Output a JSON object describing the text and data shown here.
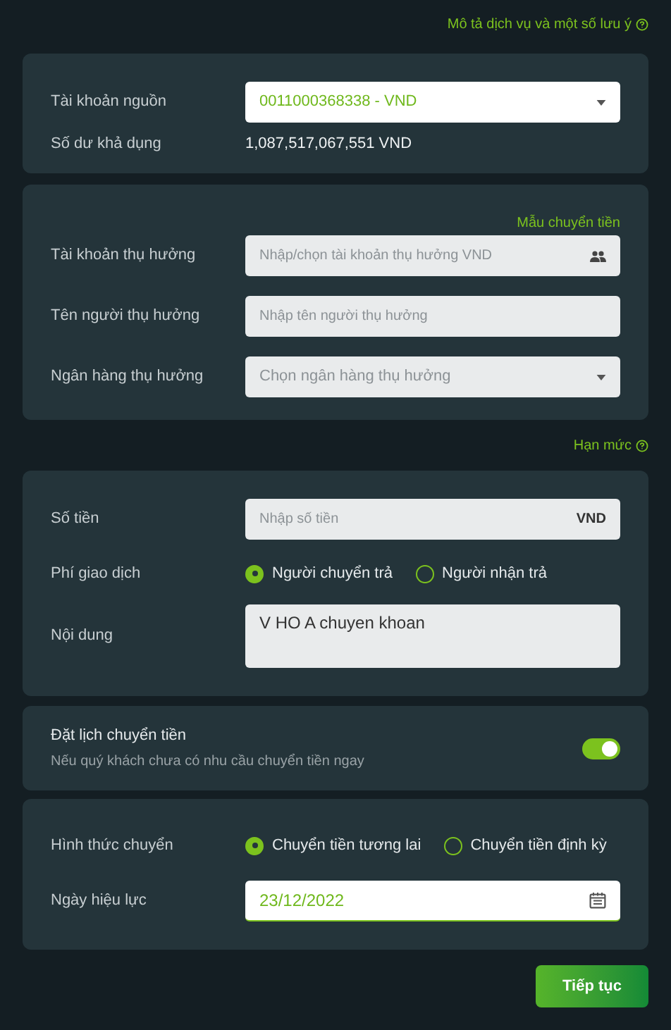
{
  "help_link": "Mô tả dịch vụ và một số lưu ý",
  "source": {
    "label": "Tài khoản nguồn",
    "account": "0011000368338 - VND",
    "balance_label": "Số dư khả dụng",
    "balance": "1,087,517,067,551 VND"
  },
  "beneficiary": {
    "template_link": "Mẫu chuyển tiền",
    "fields": [
      {
        "kind": "contact",
        "label": "Tài khoản thụ hưởng",
        "placeholder": "Nhập/chọn tài khoản thụ hưởng VND"
      },
      {
        "kind": "text",
        "label": "Tên người thụ hưởng",
        "placeholder": "Nhập tên người thụ hưởng"
      },
      {
        "kind": "select",
        "label": "Ngân hàng thụ hưởng",
        "placeholder": "Chọn ngân hàng thụ hưởng"
      }
    ]
  },
  "limit_link": "Hạn mức",
  "transfer": {
    "amount_label": "Số tiền",
    "amount_placeholder": "Nhập số tiền",
    "currency": "VND",
    "fee_label": "Phí giao dịch",
    "fee_options": [
      {
        "label": "Người chuyển trả",
        "selected": true
      },
      {
        "label": "Người nhận trả",
        "selected": false
      }
    ],
    "content_label": "Nội dung",
    "content": "V HO A chuyen khoan"
  },
  "schedule": {
    "title": "Đặt lịch chuyển tiền",
    "subtitle": "Nếu quý khách chưa có nhu cầu chuyển tiền ngay",
    "on": true
  },
  "schedule_details": {
    "type_label": "Hình thức chuyển",
    "type_options": [
      {
        "label": "Chuyển tiền tương lai",
        "selected": true
      },
      {
        "label": "Chuyển tiền định kỳ",
        "selected": false
      }
    ],
    "date_label": "Ngày hiệu lực",
    "date": "23/12/2022"
  },
  "continue_button": "Tiếp tục"
}
